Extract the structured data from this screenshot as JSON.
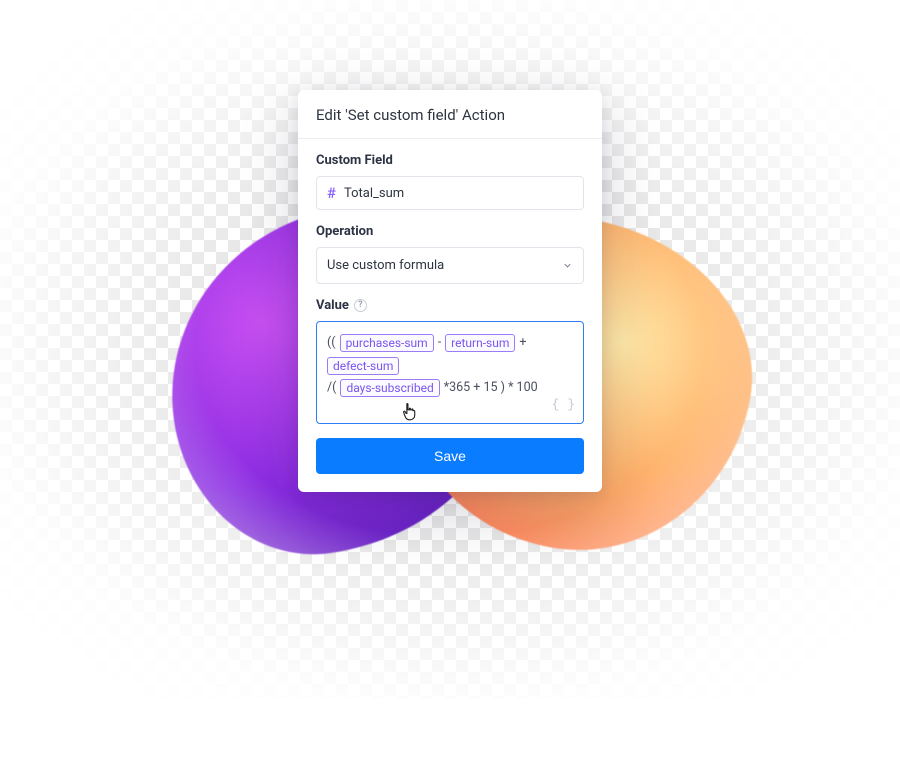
{
  "modal": {
    "title": "Edit 'Set custom field' Action",
    "customField": {
      "label": "Custom Field",
      "value": "Total_sum"
    },
    "operation": {
      "label": "Operation",
      "value": "Use custom formula"
    },
    "value": {
      "label": "Value",
      "formula": {
        "line1_prefix": "((",
        "token1": "purchases-sum",
        "minus": "-",
        "token2": "return-sum",
        "plus": "+",
        "token3": "defect-sum",
        "line2_prefix": "/(",
        "token4": "days-subscribed",
        "tail": "*365 + 15 ) * 100"
      }
    },
    "saveLabel": "Save"
  }
}
